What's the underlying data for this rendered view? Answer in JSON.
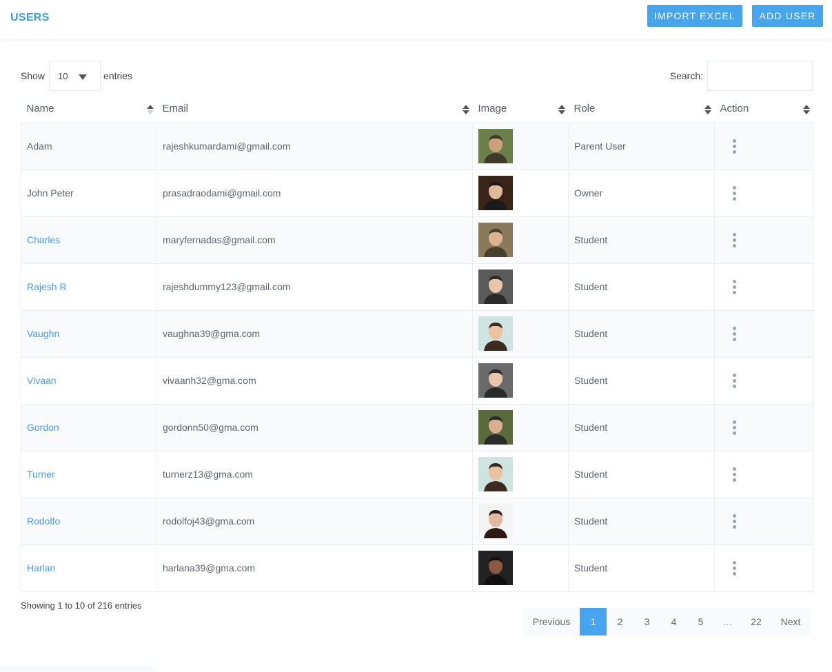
{
  "header": {
    "title": "USERS",
    "import_label": "IMPORT EXCEL",
    "add_label": "ADD USER"
  },
  "controls": {
    "show_label": "Show",
    "entries_label": "entries",
    "length_value": "10",
    "search_label": "Search:",
    "search_value": ""
  },
  "table": {
    "columns": [
      "Name",
      "Email",
      "Image",
      "Role",
      "Action"
    ],
    "rows": [
      {
        "name": "Adam",
        "email": "rajeshkumardami@gmail.com",
        "role": "Parent User",
        "link": false
      },
      {
        "name": "John Peter",
        "email": "prasadraodami@gmail.com",
        "role": "Owner",
        "link": false
      },
      {
        "name": "Charles",
        "email": "maryfernadas@gmail.com",
        "role": "Student",
        "link": true
      },
      {
        "name": "Rajesh R",
        "email": "rajeshdummy123@gmail.com",
        "role": "Student",
        "link": true
      },
      {
        "name": "Vaughn",
        "email": "vaughna39@gma.com",
        "role": "Student",
        "link": true
      },
      {
        "name": "Vivaan",
        "email": "vivaanh32@gma.com",
        "role": "Student",
        "link": true
      },
      {
        "name": "Gordon",
        "email": "gordonn50@gma.com",
        "role": "Student",
        "link": true
      },
      {
        "name": "Turner",
        "email": "turnerz13@gma.com",
        "role": "Student",
        "link": true
      },
      {
        "name": "Rodolfo",
        "email": "rodolfoj43@gma.com",
        "role": "Student",
        "link": true
      },
      {
        "name": "Harlan",
        "email": "harlana39@gma.com",
        "role": "Student",
        "link": true
      }
    ]
  },
  "info": "Showing 1 to 10 of 216 entries",
  "pagination": {
    "previous": "Previous",
    "pages": [
      "1",
      "2",
      "3",
      "4",
      "5"
    ],
    "ellipsis": "…",
    "last": "22",
    "next": "Next"
  }
}
